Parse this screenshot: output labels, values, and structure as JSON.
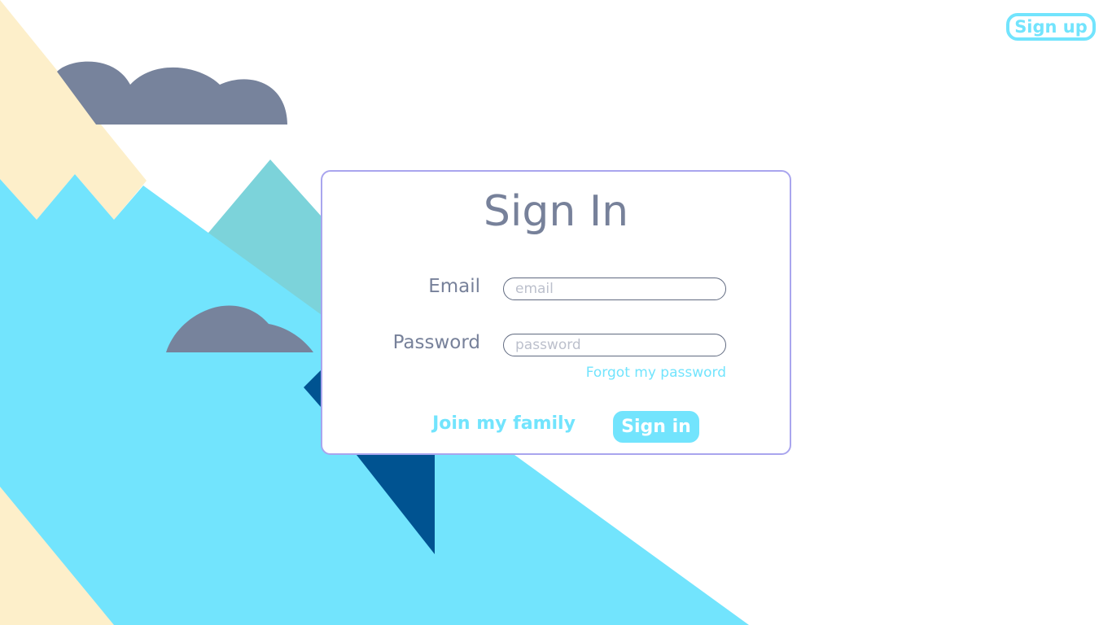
{
  "header": {
    "signup_label": "Sign up"
  },
  "signin_card": {
    "title": "Sign In",
    "email_label": "Email",
    "email_placeholder": "email",
    "email_value": "",
    "password_label": "Password",
    "password_placeholder": "password",
    "password_value": "",
    "forgot_label": "Forgot my password",
    "join_label": "Join my family",
    "signin_label": "Sign in"
  },
  "colors": {
    "accent": "#72e4fd",
    "card_border": "#a9a5ee",
    "text_muted": "#77819a",
    "cloud": "#77839c",
    "sand": "#fdefca",
    "teal": "#7cd3da",
    "navy": "#005391"
  }
}
